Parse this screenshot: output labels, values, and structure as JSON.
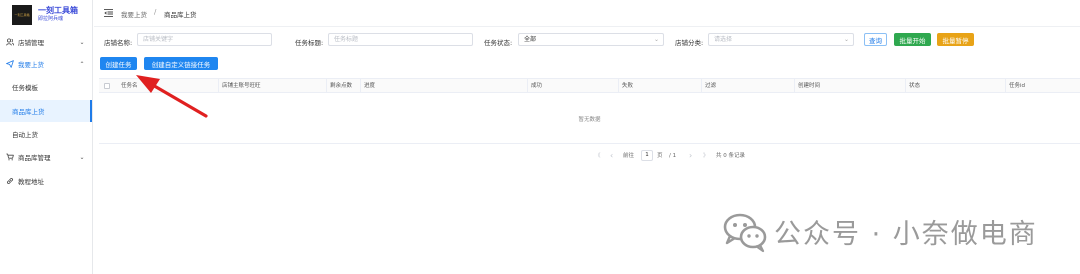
{
  "brand": {
    "title": "一刻工具箱",
    "subtitle": "即拉阿兵魂",
    "logo_mark": "一刻工具箱"
  },
  "sidebar": {
    "items": [
      {
        "label": "店铺管理",
        "icon": "user-group-icon",
        "chevron": "⌄"
      },
      {
        "label": "我要上货",
        "icon": "send-icon",
        "chevron": "⌃"
      },
      {
        "label": "任务模板"
      },
      {
        "label": "商品库上货"
      },
      {
        "label": "自动上货"
      },
      {
        "label": "商品库管理",
        "icon": "cart-icon",
        "chevron": "⌄"
      },
      {
        "label": "教程地址",
        "icon": "link-icon"
      }
    ]
  },
  "header": {
    "breadcrumb": [
      "我要上货",
      "商品库上货"
    ],
    "separator": "/"
  },
  "filters": {
    "shop_name_label": "店铺名称:",
    "shop_name_placeholder": "店铺关键字",
    "task_title_label": "任务标题:",
    "task_title_placeholder": "任务标题",
    "task_status_label": "任务状态:",
    "task_status_value": "全部",
    "shop_category_label": "店铺分类:",
    "shop_category_placeholder": "请选择"
  },
  "buttons": {
    "query": "查询",
    "batch_start": "批量开始",
    "batch_pause": "批量暂停",
    "create_task": "创建任务",
    "create_custom": "创建自定义链接任务"
  },
  "table": {
    "columns": [
      "任务名",
      "店铺主账号旺旺",
      "剩余点数",
      "进度",
      "成功",
      "失败",
      "过滤",
      "创建时间",
      "状态",
      "任务id"
    ],
    "empty_text": "暂无数据"
  },
  "pagination": {
    "first": "《",
    "prev": "‹",
    "goto_label": "前往",
    "page": "1",
    "page_label": "页",
    "total_pages": "/ 1",
    "next": "›",
    "last": "》",
    "total_records": "共 0 条记录"
  },
  "watermark": {
    "text": "公众号 · 小奈做电商"
  },
  "colors": {
    "primary": "#1f86f0",
    "success": "#2fa84f",
    "warning": "#e8a317",
    "annotation": "#e02020"
  }
}
